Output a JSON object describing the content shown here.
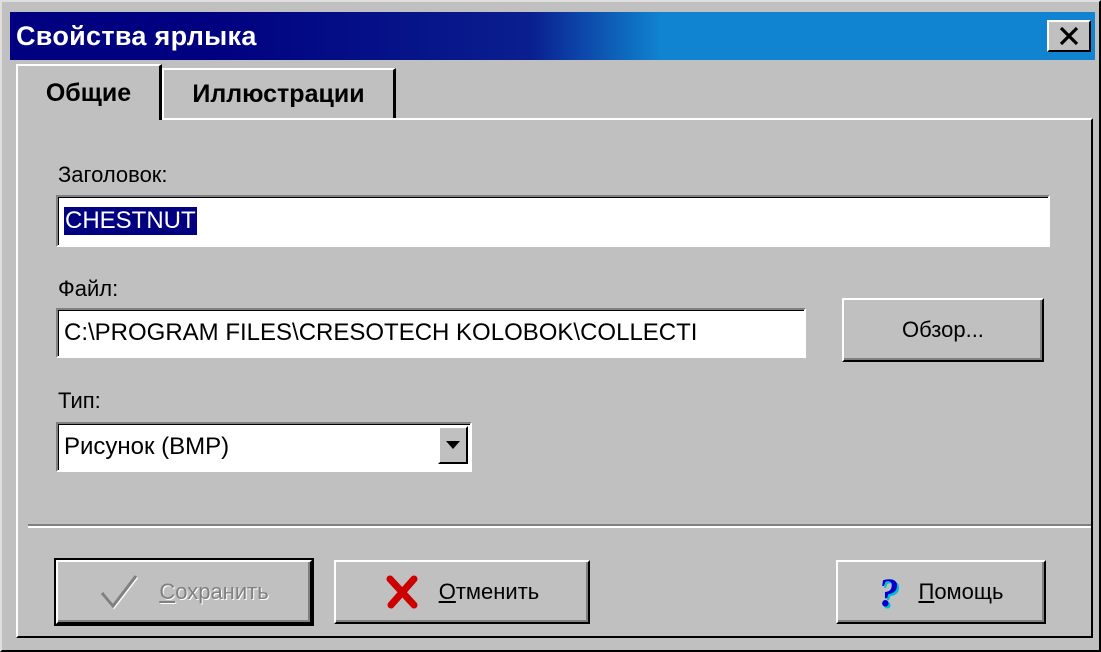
{
  "window": {
    "title": "Свойства ярлыка",
    "close_symbol": "✕"
  },
  "tabs": [
    {
      "label": "Общие",
      "active": true
    },
    {
      "label": "Иллюстрации",
      "active": false
    }
  ],
  "form": {
    "title_label": "Заголовок:",
    "title_value": "CHESTNUT",
    "file_label": "Файл:",
    "file_value": "C:\\PROGRAM FILES\\CRESOTECH KOLOBOK\\COLLECTI",
    "browse_label": "Обзор...",
    "type_label": "Тип:",
    "type_value": "Рисунок (BMP)"
  },
  "buttons": {
    "save": {
      "first": "С",
      "rest": "охранить",
      "icon": "checkmark-icon",
      "enabled": false
    },
    "cancel": {
      "first": "О",
      "rest": "тменить",
      "icon": "red-x-icon",
      "enabled": true
    },
    "help": {
      "first": "П",
      "rest": "омощь",
      "icon": "question-mark-icon",
      "enabled": true
    }
  },
  "colors": {
    "title_gradient_start": "#000080",
    "title_gradient_end": "#1084d0",
    "face": "#c0c0c0",
    "selection": "#000080",
    "cancel_icon": "#cc0000",
    "help_icon": "#0000cc"
  }
}
